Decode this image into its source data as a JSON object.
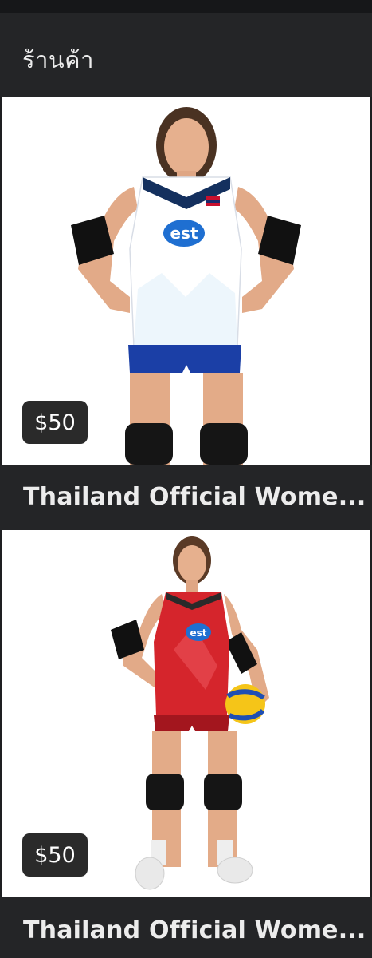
{
  "header": {
    "title": "ร้านค้า"
  },
  "products": [
    {
      "price": "$50",
      "title": "Thailand Official Wome...",
      "image_icon": "volleyball-player-white-jersey-photo",
      "jersey_color": "#ffffff",
      "shorts_color": "#1b3fa6",
      "accent": "#14305e"
    },
    {
      "price": "$50",
      "title": "Thailand Official Wome...",
      "image_icon": "volleyball-player-red-jersey-photo",
      "jersey_color": "#d5252c",
      "shorts_color": "#a3161e",
      "accent": "#8e1218"
    }
  ]
}
